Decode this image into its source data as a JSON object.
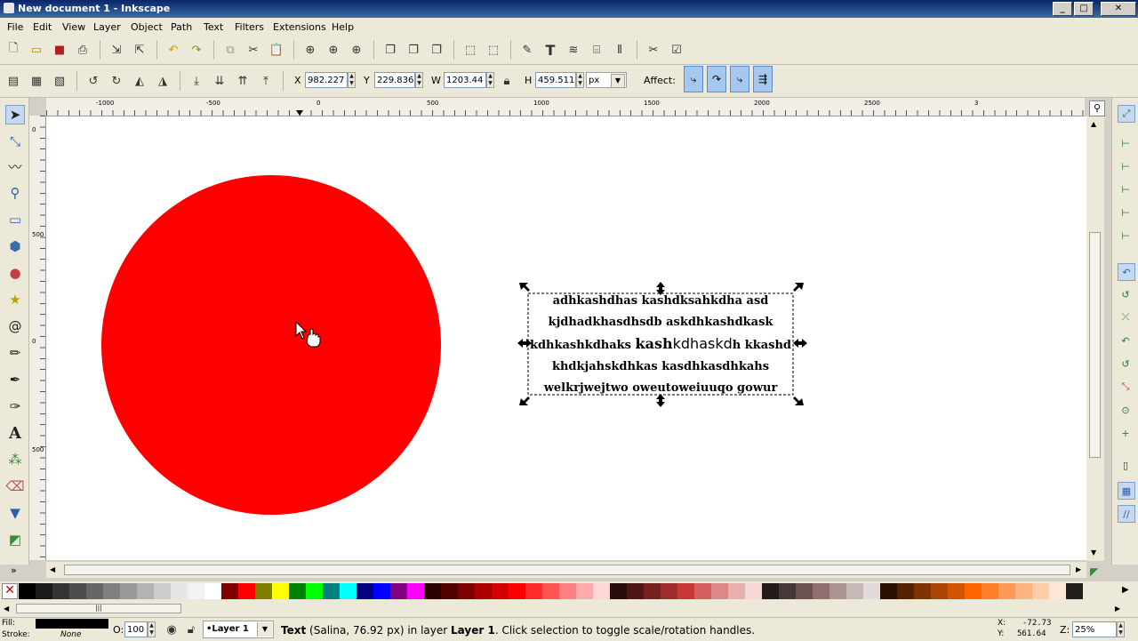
{
  "window": {
    "title": "New document 1 - Inkscape",
    "min": "_",
    "max": "□",
    "close": "✕"
  },
  "menu": [
    "File",
    "Edit",
    "View",
    "Layer",
    "Object",
    "Path",
    "Text",
    "Filters",
    "Extensions",
    "Help"
  ],
  "controls": {
    "x_label": "X",
    "x_value": "982.227",
    "y_label": "Y",
    "y_value": "229.836",
    "w_label": "W",
    "w_value": "1203.44",
    "h_label": "H",
    "h_value": "459.511",
    "unit": "px",
    "affect_label": "Affect:"
  },
  "ruler": {
    "h": [
      "-1000",
      "-500",
      "0",
      "500",
      "1000",
      "1500",
      "2000",
      "2500",
      "3"
    ],
    "v": [
      "0",
      "500",
      "0",
      "500"
    ]
  },
  "canvas": {
    "circle_color": "#ff0000",
    "text_lines": [
      "adhkashdhas kashdksahkdha asd",
      "kjdhadkhasdhsdb askdhkashdkask",
      "kdhkashkdhaks kashkdhaskdh kkashd",
      "khdkjahskdhkas kasdhkasdhkahs",
      "welkrjwejtwo oweutoweiuuqo gowur"
    ]
  },
  "palette": [
    "#000000",
    "#1a1a1a",
    "#333333",
    "#4d4d4d",
    "#666666",
    "#808080",
    "#999999",
    "#b3b3b3",
    "#cccccc",
    "#e6e6e6",
    "#f2f2f2",
    "#ffffff",
    "#800000",
    "#ff0000",
    "#808000",
    "#ffff00",
    "#008000",
    "#00ff00",
    "#008080",
    "#00ffff",
    "#000080",
    "#0000ff",
    "#800080",
    "#ff00ff",
    "#2b0000",
    "#550000",
    "#800000",
    "#aa0000",
    "#d40000",
    "#ff0000",
    "#ff2a2a",
    "#ff5555",
    "#ff8080",
    "#ffaaaa",
    "#ffd5d5",
    "#280b0b",
    "#501616",
    "#782121",
    "#a02c2c",
    "#c83737",
    "#d35f5f",
    "#de8787",
    "#e9afaf",
    "#f4d7d7",
    "#241c1c",
    "#483737",
    "#6c5353",
    "#916f6f",
    "#ac9393",
    "#c8b7b7",
    "#e3dbdb",
    "#2b1100",
    "#552200",
    "#803300",
    "#aa4400",
    "#d45500",
    "#ff6600",
    "#ff7f2a",
    "#ff9955",
    "#ffb380",
    "#ffccaa",
    "#ffe6d5",
    "#241f1c"
  ],
  "status": {
    "fill_label": "Fill:",
    "stroke_label": "Stroke:",
    "stroke_value": "None",
    "opacity_label": "O:",
    "opacity_value": "100",
    "layer_name": "•Layer 1",
    "message_pre": "Text",
    "message_paren": "(Salina, 76.92 px) in layer",
    "message_layer": "Layer 1",
    "message_post": ". Click selection to toggle scale/rotation handles.",
    "coord_x_label": "X:",
    "coord_x": "-72.73",
    "coord_y_label": "Y:",
    "coord_y": "561.64",
    "zoom_label": "Z:",
    "zoom_value": "25%"
  }
}
